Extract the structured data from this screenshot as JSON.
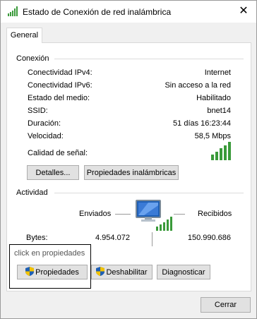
{
  "window": {
    "title": "Estado de Conexión de red inalámbrica",
    "close_label": "✕"
  },
  "tabs": [
    {
      "label": "General"
    }
  ],
  "connection": {
    "heading": "Conexión",
    "rows": [
      {
        "label": "Conectividad IPv4:",
        "value": "Internet"
      },
      {
        "label": "Conectividad IPv6:",
        "value": "Sin acceso a la red"
      },
      {
        "label": "Estado del medio:",
        "value": "Habilitado"
      },
      {
        "label": "SSID:",
        "value": "bnet14"
      },
      {
        "label": "Duración:",
        "value": "51 días 16:23:44"
      },
      {
        "label": "Velocidad:",
        "value": "58,5 Mbps"
      }
    ],
    "signal_label": "Calidad de señal:",
    "signal_bars_active": 5,
    "signal_bars_total": 5,
    "details_button": "Detalles...",
    "wireless_props_button": "Propiedades inalámbricas"
  },
  "activity": {
    "heading": "Actividad",
    "sent_label": "Enviados",
    "received_label": "Recibidos",
    "bytes_label": "Bytes:",
    "bytes_sent": "4.954.072",
    "bytes_received": "150.990.686"
  },
  "annotation": {
    "text": "click en propiedades"
  },
  "buttons": {
    "properties": "Propiedades",
    "disable": "Deshabilitar",
    "diagnose": "Diagnosticar",
    "close": "Cerrar"
  },
  "colors": {
    "signal_green": "#3a9a3a",
    "accent_blue": "#1e5fb4",
    "shield_yellow": "#f2c200"
  }
}
